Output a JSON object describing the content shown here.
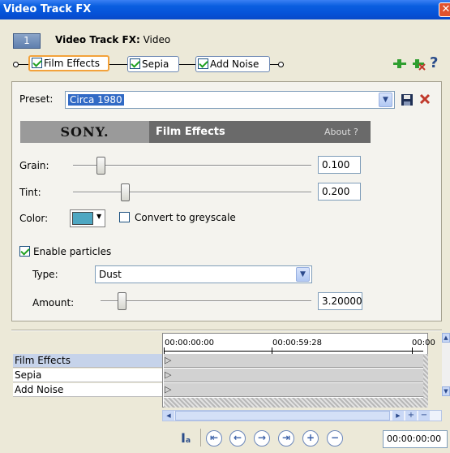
{
  "window": {
    "title": "Video Track FX",
    "close": "✕"
  },
  "header": {
    "number": "1",
    "title_bold": "Video Track FX:",
    "title_rest": " Video"
  },
  "chain": {
    "items": [
      {
        "label": "Film Effects",
        "checked": true,
        "active": true
      },
      {
        "label": "Sepia",
        "checked": true,
        "active": false
      },
      {
        "label": "Add Noise",
        "checked": true,
        "active": false
      }
    ],
    "help": "?"
  },
  "preset": {
    "label": "Preset:",
    "value": "Circa 1980"
  },
  "plugin": {
    "brand": "SONY.",
    "name": "Film Effects",
    "about": "About  ?"
  },
  "grain": {
    "label": "Grain:",
    "value": "0.100",
    "level": 0.1
  },
  "tint": {
    "label": "Tint:",
    "value": "0.200",
    "level": 0.2
  },
  "color": {
    "label": "Color:",
    "swatch": "#4ea7c2",
    "greyscale_label": "Convert to greyscale",
    "greyscale_checked": false
  },
  "particles": {
    "label": "Enable particles",
    "checked": true
  },
  "type": {
    "label": "Type:",
    "value": "Dust"
  },
  "amount": {
    "label": "Amount:",
    "value": "3.20000",
    "level": 0.08
  },
  "timeline": {
    "times": [
      "00:00:00:00",
      "00:00:59:28",
      "00:00"
    ],
    "rows": [
      "Film Effects",
      "Sepia",
      "Add Noise"
    ],
    "current_time": "00:00:00:00"
  },
  "colors": {
    "accent": "#316ac5",
    "titlebar": "#0552d8",
    "active_border": "#f3a23b"
  }
}
